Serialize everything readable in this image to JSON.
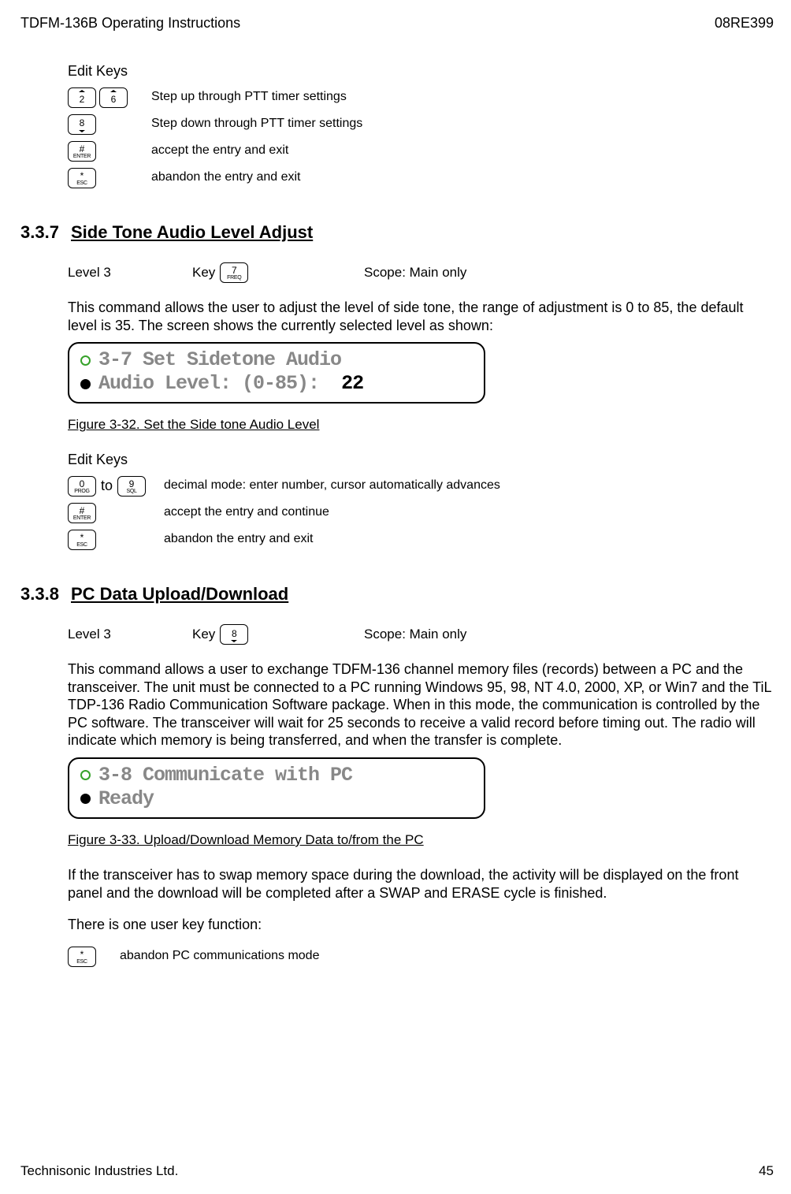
{
  "header": {
    "left": "TDFM-136B Operating Instructions",
    "right": "08RE399"
  },
  "editKeys1": {
    "title": "Edit Keys",
    "rows": [
      {
        "keys": [
          {
            "t": "up",
            "big": "2"
          },
          {
            "t": "up",
            "big": "6"
          }
        ],
        "desc": "Step up through PTT timer settings"
      },
      {
        "keys": [
          {
            "t": "dn",
            "big": "8"
          }
        ],
        "desc": "Step down through PTT timer settings"
      },
      {
        "keys": [
          {
            "t": "",
            "big": "#",
            "sub": "ENTER"
          }
        ],
        "desc": "accept the entry and exit"
      },
      {
        "keys": [
          {
            "t": "",
            "big": "*",
            "sub": "ESC"
          }
        ],
        "desc": "abandon the entry and exit"
      }
    ]
  },
  "sec337": {
    "num": "3.3.7",
    "title": "Side Tone Audio Level Adjust",
    "level": "Level 3",
    "keyLabel": "Key",
    "key": {
      "big": "7",
      "sub": "FREQ"
    },
    "scope": "Scope: Main only",
    "body": "This command allows the user to adjust the level of side tone, the range of adjustment is 0 to 85, the default level is 35. The screen shows the currently selected level as shown:",
    "lcd": {
      "line1": "3-7 Set Sidetone Audio",
      "line2a": "Audio Level: (0-85): ",
      "line2b": " 22"
    },
    "figcap": "Figure 3-32. Set the Side tone Audio Level",
    "edit": {
      "title": "Edit Keys",
      "rows": [
        {
          "keys": [
            {
              "big": "0",
              "sub": "PROG"
            }
          ],
          "to": "to",
          "keys2": [
            {
              "big": "9",
              "sub": "SQL"
            }
          ],
          "desc": "decimal mode: enter number, cursor automatically advances"
        },
        {
          "keys": [
            {
              "big": "#",
              "sub": "ENTER"
            }
          ],
          "desc": "accept the entry and continue"
        },
        {
          "keys": [
            {
              "big": "*",
              "sub": "ESC"
            }
          ],
          "desc": "abandon the entry and exit"
        }
      ]
    }
  },
  "sec338": {
    "num": "3.3.8",
    "title": "PC Data Upload/Download",
    "level": "Level 3",
    "keyLabel": "Key",
    "key": {
      "t": "dn",
      "big": "8"
    },
    "scope": "Scope: Main only",
    "body1": "This command allows a user to exchange TDFM-136 channel memory files (records) between a PC and the transceiver. The unit must be connected to a PC running Windows 95, 98, NT 4.0, 2000, XP, or Win7 and the TiL TDP-136 Radio Communication Software package. When in this mode, the communication is controlled by the PC software. The transceiver will wait for 25 seconds to receive a valid record before timing out. The radio will indicate which memory is being transferred, and when the transfer is complete.",
    "lcd": {
      "line1": "3-8 Communicate with PC",
      "line2": "Ready"
    },
    "figcap": "Figure 3-33. Upload/Download Memory Data to/from the PC",
    "body2": "If the transceiver has to swap memory space during the download, the activity will be displayed on the front panel and the download will be completed after a SWAP and ERASE cycle is finished.",
    "body3": "There is one user key function:",
    "lastKey": {
      "big": "*",
      "sub": "ESC"
    },
    "lastDesc": "abandon PC communications mode"
  },
  "footer": {
    "left": "Technisonic Industries Ltd.",
    "right": "45"
  }
}
